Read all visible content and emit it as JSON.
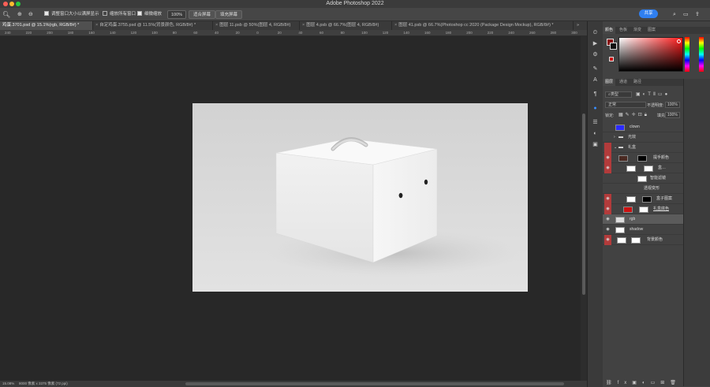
{
  "window": {
    "title": "Adobe Photoshop 2022"
  },
  "options_bar": {
    "resize_windows": "调整窗口大小以满屏显示",
    "zoom_all": "缩放所有窗口",
    "scrubby_zoom": "细微缩放",
    "zoom_value": "100%",
    "fit_screen": "适合屏幕",
    "fill_screen": "填充屏幕",
    "share": "共享"
  },
  "tabs": [
    {
      "label": "鸡蛋.3701.psd @ 15.1%(rgb, RGB/8#) *",
      "active": true
    },
    {
      "label": "自定鸡蛋.3755.psd @ 11.5%(背景颜色, RGB/8#) *",
      "active": false
    },
    {
      "label": "图层 11.psb @ 50%(图层 4, RGB/8#)",
      "active": false
    },
    {
      "label": "图层 4.psb @ 66.7%(图层 4, RGB/8#)",
      "active": false
    },
    {
      "label": "图层 41.psb @ 66.7%(Photoshop cc 2020  (Package Design Mockup), RGB/8#) *",
      "active": false
    }
  ],
  "ruler_labels": [
    "240",
    "220",
    "200",
    "180",
    "160",
    "140",
    "120",
    "100",
    "80",
    "60",
    "40",
    "20",
    "0",
    "20",
    "40",
    "60",
    "80",
    "100",
    "120",
    "140",
    "160",
    "180",
    "200",
    "220",
    "240",
    "260",
    "280",
    "300"
  ],
  "status": {
    "zoom": "15.08%",
    "size": "8000 像素 x 3375 像素 (72 ppi)"
  },
  "color_panel": {
    "tabs": [
      "颜色",
      "色板",
      "渐变",
      "图案"
    ]
  },
  "layers_panel": {
    "tabs": [
      "图层",
      "通道",
      "路径"
    ],
    "filter_label": "类型",
    "blend_mode": "正常",
    "opacity_label": "不透明度:",
    "opacity_value": "100%",
    "lock_label": "锁定:",
    "fill_label": "填充:",
    "fill_value": "100%",
    "layers": [
      {
        "name": "clown",
        "indent": 0,
        "eye": false,
        "selected": false,
        "red": false,
        "thumb": "#2b2bff"
      },
      {
        "name": "光效",
        "indent": 0,
        "eye": false,
        "selected": false,
        "red": false,
        "thumb": "folder"
      },
      {
        "name": "礼盒",
        "indent": 0,
        "eye": true,
        "selected": false,
        "red": true,
        "thumb": "folder"
      },
      {
        "name": "提手颜色",
        "indent": 1,
        "eye": true,
        "selected": false,
        "red": true,
        "thumb": "#4a2a22"
      },
      {
        "name": "盒…",
        "indent": 1,
        "eye": true,
        "selected": false,
        "red": true,
        "thumb": "#ffffff"
      },
      {
        "name": "智能滤镜",
        "indent": 2,
        "eye": false,
        "selected": false,
        "red": false,
        "thumb": "#ffffff"
      },
      {
        "name": "透视变形",
        "indent": 2,
        "eye": false,
        "selected": false,
        "red": false,
        "thumb": "none"
      },
      {
        "name": "盒子图案",
        "indent": 1,
        "eye": true,
        "selected": false,
        "red": true,
        "thumb": "#ffffff"
      },
      {
        "name": "礼盒底色",
        "indent": 1,
        "eye": true,
        "selected": false,
        "red": true,
        "thumb": "#cc1111"
      },
      {
        "name": "rgb",
        "indent": 0,
        "eye": true,
        "selected": true,
        "red": false,
        "thumb": "#dddddd"
      },
      {
        "name": "shadow",
        "indent": 0,
        "eye": true,
        "selected": false,
        "red": false,
        "thumb": "#ffffff"
      },
      {
        "name": "背景颜色",
        "indent": 0,
        "eye": true,
        "selected": false,
        "red": true,
        "thumb": "#ffffff"
      }
    ]
  },
  "colors": {
    "accent": "#2f7ff0",
    "fg_color": "#8a1313",
    "bg_color": "#111111"
  }
}
